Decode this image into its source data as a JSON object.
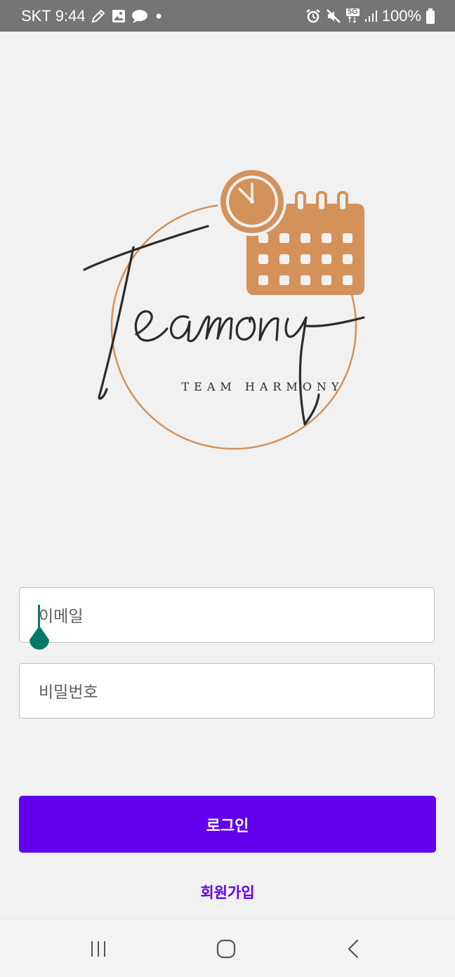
{
  "status_bar": {
    "carrier": "SKT",
    "time": "9:44",
    "network": "5G",
    "battery": "100%",
    "left_icons": [
      "pencil-icon",
      "image-icon",
      "chat-icon",
      "dot-icon"
    ],
    "right_icons": [
      "alarm-icon",
      "mute-icon",
      "5g-icon",
      "signal-icon",
      "battery-icon"
    ]
  },
  "logo": {
    "wordmark": "Teamony",
    "tagline": "TEAM HARMONY",
    "accent_color": "#d4915a"
  },
  "form": {
    "email_placeholder": "이메일",
    "password_placeholder": "비밀번호"
  },
  "login_button": {
    "label": "로그인",
    "color": "#6200ee"
  },
  "signup_link": {
    "label": "회원가입"
  },
  "nav_bar": {
    "buttons": [
      "recent-apps-icon",
      "home-icon",
      "back-icon"
    ]
  }
}
